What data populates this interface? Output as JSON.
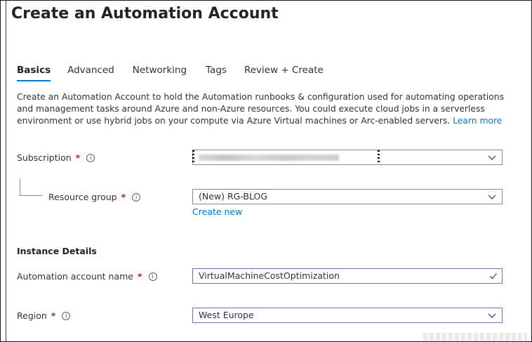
{
  "header": {
    "title": "Create an Automation Account",
    "more": "···"
  },
  "tabs": [
    {
      "label": "Basics",
      "active": true
    },
    {
      "label": "Advanced",
      "active": false
    },
    {
      "label": "Networking",
      "active": false
    },
    {
      "label": "Tags",
      "active": false
    },
    {
      "label": "Review + Create",
      "active": false
    }
  ],
  "description": {
    "text": "Create an Automation Account to hold the Automation runbooks & configuration used for automating operations and management tasks around Azure and non-Azure resources. You could execute cloud jobs in a serverless environment or use hybrid jobs on your compute via Azure Virtual machines or Arc-enabled servers.",
    "link": "Learn more"
  },
  "form": {
    "subscription": {
      "label": "Subscription",
      "required": "*",
      "value": ""
    },
    "resource_group": {
      "label": "Resource group",
      "required": "*",
      "value": "(New) RG-BLOG",
      "create_new": "Create new"
    },
    "instance_details_title": "Instance Details",
    "account_name": {
      "label": "Automation account name",
      "required": "*",
      "value": "VirtualMachineCostOptimization"
    },
    "region": {
      "label": "Region",
      "required": "*",
      "value": "West Europe"
    }
  },
  "icons": {
    "info": "i",
    "chevron": "chevron-down-icon",
    "check": "checkmark-icon"
  },
  "colors": {
    "accent": "#0078d4",
    "required": "#a4262c",
    "valid": "#107c10",
    "focus_border": "#8764b8"
  }
}
